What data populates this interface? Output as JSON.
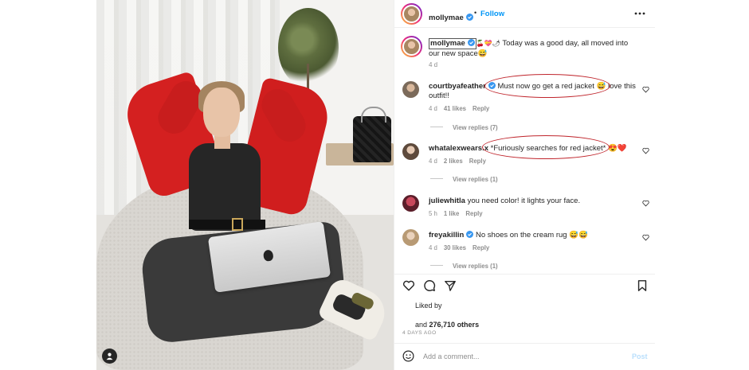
{
  "header": {
    "username": "mollymae",
    "dot": "•",
    "follow_label": "Follow"
  },
  "caption": {
    "username": "mollymae",
    "emojis": "🍒💝🌶",
    "text": " Today was a good day, all moved into our new space😅",
    "time": "4 d"
  },
  "comments": [
    {
      "username": "courtbyafeather",
      "verified": true,
      "text": "Must now go get a red jacket 😅 love this outfit!!",
      "time": "4 d",
      "likes": "41 likes",
      "reply_label": "Reply",
      "view_replies": "View replies (7)"
    },
    {
      "username": "whatalexwears.x",
      "verified": false,
      "text": "*Furiously searches for red jacket* 😍❤️",
      "time": "4 d",
      "likes": "2 likes",
      "reply_label": "Reply",
      "view_replies": "View replies (1)"
    },
    {
      "username": "juliewhitla",
      "verified": false,
      "text": "you need color! it lights your face.",
      "time": "5 h",
      "likes": "1 like",
      "reply_label": "Reply"
    },
    {
      "username": "freyakillin",
      "verified": true,
      "text": "No shoes on the cream rug 😅😅",
      "time": "4 d",
      "likes": "30 likes",
      "reply_label": "Reply",
      "view_replies": "View replies (1)"
    }
  ],
  "actions": {
    "liked_by": "Liked by",
    "likes_prefix": "and ",
    "likes_count": "276,710 others",
    "date": "4 DAYS AGO"
  },
  "add_comment": {
    "placeholder": "Add a comment...",
    "post_label": "Post"
  },
  "icons": {
    "verified": "verified-badge-icon",
    "more": "more-horizontal-icon",
    "like": "heart-icon",
    "comment": "comment-icon",
    "share": "paper-plane-icon",
    "save": "bookmark-icon",
    "emoji": "emoji-smile-icon",
    "user_tag": "user-tag-icon"
  },
  "colors": {
    "link_blue": "#0095f6",
    "verified_blue": "#3897f0",
    "annotation_red": "#c0262d",
    "muted_text": "#8e8e8e"
  }
}
